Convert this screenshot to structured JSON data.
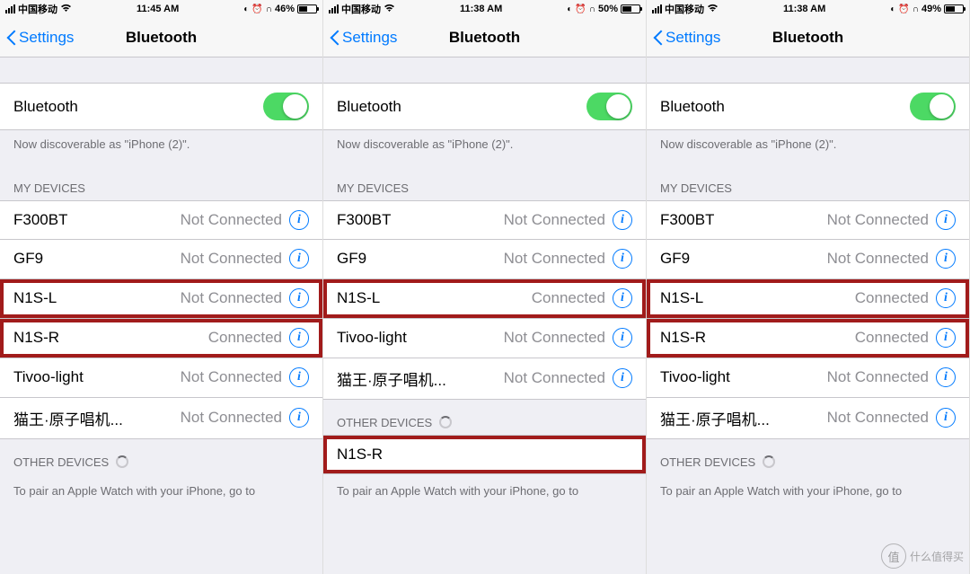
{
  "screens": [
    {
      "status": {
        "carrier": "中国移动",
        "time": "11:45 AM",
        "battery_pct": "46%",
        "battery_fill": 9
      },
      "nav": {
        "back": "Settings",
        "title": "Bluetooth"
      },
      "bluetooth_label": "Bluetooth",
      "discoverable": "Now discoverable as \"iPhone (2)\".",
      "my_devices_header": "MY DEVICES",
      "devices": [
        {
          "name": "F300BT",
          "status": "Not Connected",
          "hl": false
        },
        {
          "name": "GF9",
          "status": "Not Connected",
          "hl": false
        },
        {
          "name": "N1S-L",
          "status": "Not Connected",
          "hl": true
        },
        {
          "name": "N1S-R",
          "status": "Connected",
          "hl": true
        },
        {
          "name": "Tivoo-light",
          "status": "Not Connected",
          "hl": false
        },
        {
          "name": "猫王·原子唱机...",
          "status": "Not Connected",
          "hl": false
        }
      ],
      "other_header": "OTHER DEVICES",
      "other": [],
      "footer": "To pair an Apple Watch with your iPhone, go to"
    },
    {
      "status": {
        "carrier": "中国移动",
        "time": "11:38 AM",
        "battery_pct": "50%",
        "battery_fill": 10
      },
      "nav": {
        "back": "Settings",
        "title": "Bluetooth"
      },
      "bluetooth_label": "Bluetooth",
      "discoverable": "Now discoverable as \"iPhone (2)\".",
      "my_devices_header": "MY DEVICES",
      "devices": [
        {
          "name": "F300BT",
          "status": "Not Connected",
          "hl": false
        },
        {
          "name": "GF9",
          "status": "Not Connected",
          "hl": false
        },
        {
          "name": "N1S-L",
          "status": "Connected",
          "hl": true
        },
        {
          "name": "Tivoo-light",
          "status": "Not Connected",
          "hl": false
        },
        {
          "name": "猫王·原子唱机...",
          "status": "Not Connected",
          "hl": false
        }
      ],
      "other_header": "OTHER DEVICES",
      "other": [
        {
          "name": "N1S-R",
          "hl": true
        }
      ],
      "footer": "To pair an Apple Watch with your iPhone, go to"
    },
    {
      "status": {
        "carrier": "中国移动",
        "time": "11:38 AM",
        "battery_pct": "49%",
        "battery_fill": 10
      },
      "nav": {
        "back": "Settings",
        "title": "Bluetooth"
      },
      "bluetooth_label": "Bluetooth",
      "discoverable": "Now discoverable as \"iPhone (2)\".",
      "my_devices_header": "MY DEVICES",
      "devices": [
        {
          "name": "F300BT",
          "status": "Not Connected",
          "hl": false
        },
        {
          "name": "GF9",
          "status": "Not Connected",
          "hl": false
        },
        {
          "name": "N1S-L",
          "status": "Connected",
          "hl": true
        },
        {
          "name": "N1S-R",
          "status": "Connected",
          "hl": true
        },
        {
          "name": "Tivoo-light",
          "status": "Not Connected",
          "hl": false
        },
        {
          "name": "猫王·原子唱机...",
          "status": "Not Connected",
          "hl": false
        }
      ],
      "other_header": "OTHER DEVICES",
      "other": [],
      "footer": "To pair an Apple Watch with your iPhone, go to"
    }
  ],
  "status_icons": {
    "dnd": "◐",
    "alarm": "⏰",
    "headphones": "🎧",
    "wifi": "📶"
  },
  "watermark": {
    "badge": "值",
    "text": "什么值得买"
  }
}
